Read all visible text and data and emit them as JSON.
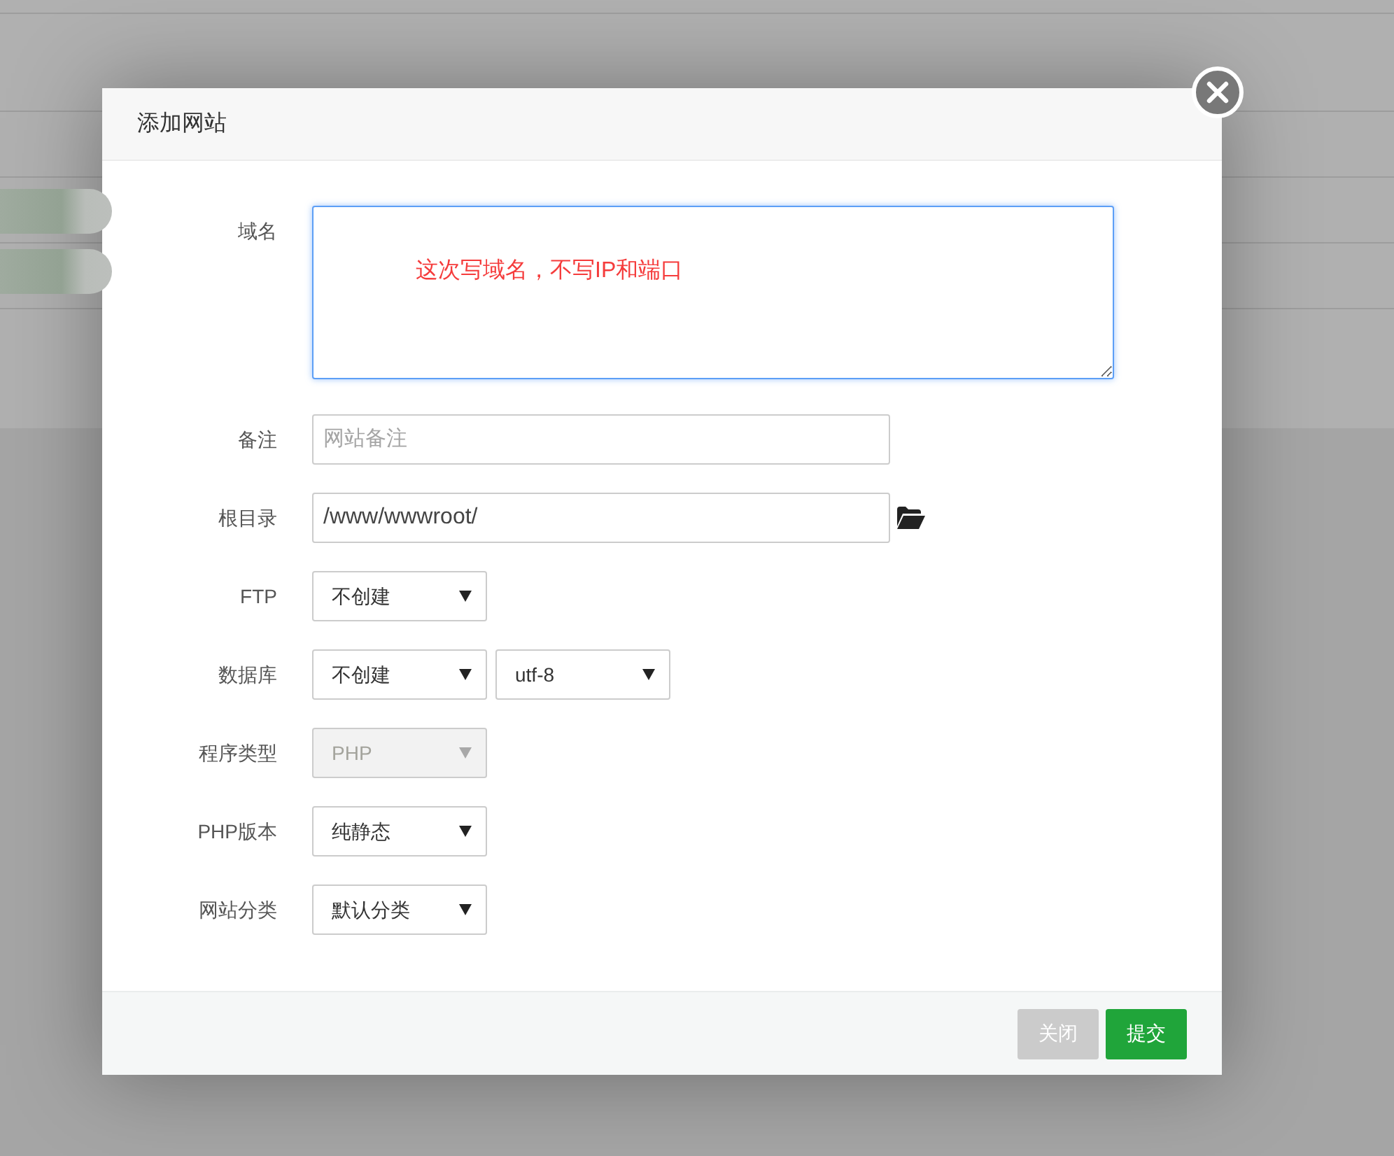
{
  "dialog": {
    "title": "添加网站",
    "fields": [
      {
        "kind": "textarea",
        "label": "域名",
        "focused": true,
        "annotation": "这次写域名，不写IP和端口"
      },
      {
        "kind": "input",
        "label": "备注",
        "placeholder": "网站备注",
        "browse": false
      },
      {
        "kind": "input",
        "label": "根目录",
        "value": "/www/wwwroot/",
        "browse": true
      },
      {
        "kind": "select",
        "label": "FTP",
        "selects": [
          {
            "value": "不创建",
            "disabled": false
          }
        ]
      },
      {
        "kind": "select",
        "label": "数据库",
        "selects": [
          {
            "value": "不创建",
            "disabled": false
          },
          {
            "value": "utf-8",
            "disabled": false
          }
        ]
      },
      {
        "kind": "select",
        "label": "程序类型",
        "selects": [
          {
            "value": "PHP",
            "disabled": true
          }
        ]
      },
      {
        "kind": "select",
        "label": "PHP版本",
        "selects": [
          {
            "value": "纯静态",
            "disabled": false
          }
        ]
      },
      {
        "kind": "select",
        "label": "网站分类",
        "selects": [
          {
            "value": "默认分类",
            "disabled": false
          }
        ]
      }
    ],
    "buttons": [
      {
        "label": "关闭",
        "kind": "cancel"
      },
      {
        "label": "提交",
        "kind": "submit"
      }
    ]
  }
}
